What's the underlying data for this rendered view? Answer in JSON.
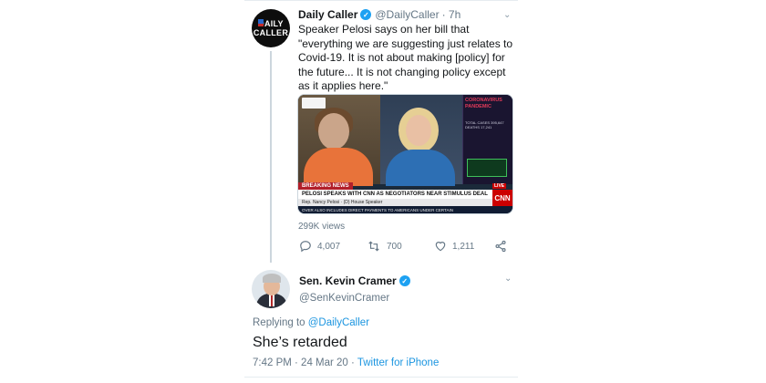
{
  "tweet1": {
    "avatar_text": [
      "DAILY",
      "CALLER"
    ],
    "name": "Daily Caller",
    "handle": "@DailyCaller",
    "time": "· 7h",
    "text": "Speaker Pelosi says on her bill that \"everything we are suggesting just relates to Covid-19. It is not about making [policy] for the future... It is not changing policy except as it applies here.\"",
    "media": {
      "side_title": "CORONAVIRUS PANDEMIC",
      "side_stats": "TOTAL CASES 395,647 DEATHS 17,241",
      "breaking": "BREAKING NEWS",
      "headline": "PELOSI SPEAKS WITH CNN AS NEGOTIATORS NEAR STIMULUS DEAL",
      "subline": "Rep. Nancy Pelosi · (D) House Speaker",
      "ticker": "OVER ALSO INCLUDES DIRECT PAYMENTS TO AMERICANS UNDER CERTAIN",
      "network": "CNN",
      "live": "LIVE"
    },
    "views": "299K views",
    "replies": "4,007",
    "retweets": "700",
    "likes": "1,211"
  },
  "tweet2": {
    "name": "Sen. Kevin Cramer",
    "handle": "@SenKevinCramer",
    "replying_prefix": "Replying to",
    "replying_to": "@DailyCaller",
    "text": "She’s retarded",
    "timestamp": "7:42 PM · 24 Mar 20 ·",
    "source": "Twitter for iPhone"
  },
  "colors": {
    "link": "#1b95e0",
    "verified": "#1da1f2",
    "muted": "#657786"
  }
}
